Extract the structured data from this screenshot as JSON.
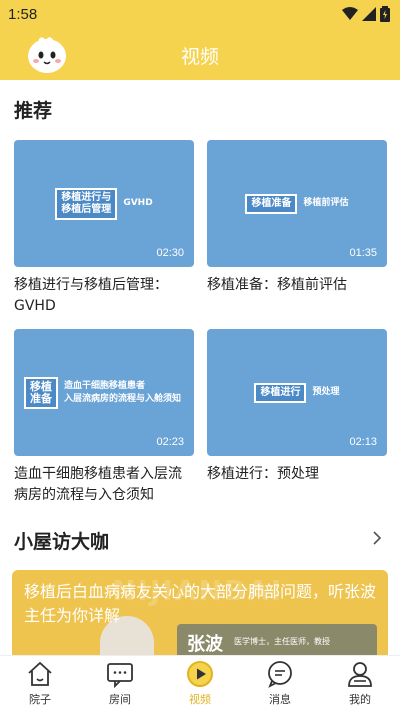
{
  "status": {
    "time": "1:58"
  },
  "appbar": {
    "title": "视频"
  },
  "sections": {
    "recommend": "推荐",
    "visit": "小屋访大咖"
  },
  "videos": [
    {
      "tag": "移植进行与\n移植后管理",
      "side": "GVHD",
      "duration": "02:30",
      "title": "移植进行与移植后管理：GVHD"
    },
    {
      "tag": "移植准备",
      "side": "移植前评估",
      "duration": "01:35",
      "title": "移植准备：移植前评估"
    },
    {
      "tag": "移植\n准备",
      "side": "造血干细胞移植患者\n入层流病房的流程与入舱须知",
      "duration": "02:23",
      "title": "造血干细胞移植患者入层流病房的流程与入仓须知"
    },
    {
      "tag": "移植进行",
      "side": "预处理",
      "duration": "02:13",
      "title": "移植进行：预处理"
    }
  ],
  "banner": {
    "text": "移植后白血病病友关心的大部分肺部问题，听张波主任为你详解",
    "bg_text": "NIJIANBAI",
    "name": "张波",
    "sub": "医学博士，主任医师，教授"
  },
  "tabs": [
    {
      "label": "院子",
      "icon": "home-icon"
    },
    {
      "label": "房间",
      "icon": "chat-room-icon"
    },
    {
      "label": "视频",
      "icon": "play-icon"
    },
    {
      "label": "消息",
      "icon": "message-icon"
    },
    {
      "label": "我的",
      "icon": "user-icon"
    }
  ],
  "colors": {
    "accent": "#f5d34e",
    "active_tab": "#e3b21f",
    "thumb": "#6aa3d6"
  }
}
